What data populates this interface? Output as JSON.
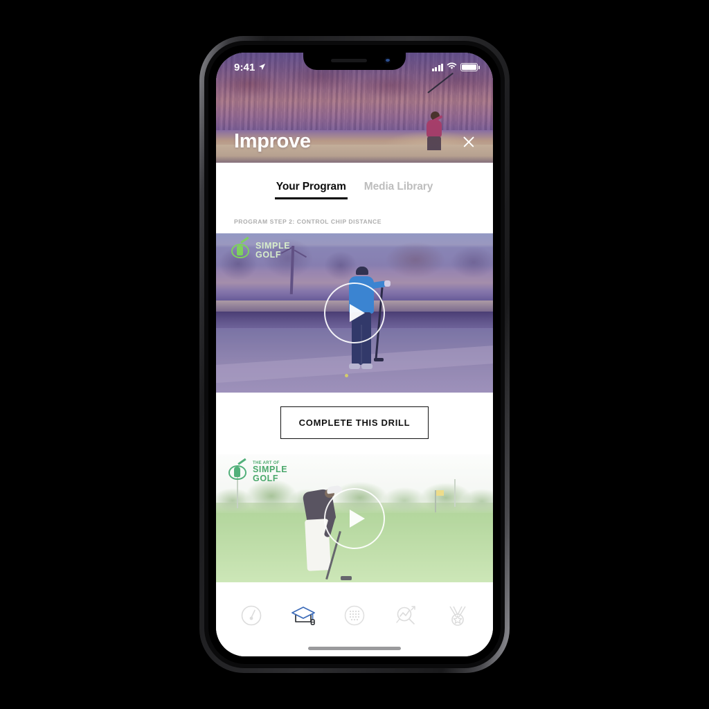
{
  "status_bar": {
    "time": "9:41",
    "location_icon": "location-arrow-icon",
    "signal_icon": "cellular-signal-icon",
    "wifi_icon": "wifi-icon",
    "battery_icon": "battery-icon"
  },
  "header": {
    "title": "Improve",
    "close_icon": "close-icon"
  },
  "tabs": [
    {
      "label": "Your Program",
      "active": true
    },
    {
      "label": "Media Library",
      "active": false
    }
  ],
  "section": {
    "label": "PROGRAM STEP 2: CONTROL CHIP DISTANCE"
  },
  "videos": [
    {
      "name": "drill-video",
      "play_icon": "play-icon",
      "logo": {
        "line1": "",
        "line2": "SIMPLE",
        "line3": "GOLF",
        "mark": "golf-swing-logo-icon"
      }
    },
    {
      "name": "secondary-video",
      "play_icon": "play-icon",
      "logo": {
        "line1": "THE ART OF",
        "line2": "SIMPLE",
        "line3": "GOLF",
        "mark": "golf-swing-logo-icon"
      }
    }
  ],
  "drill_button": {
    "label": "COMPLETE THIS DRILL"
  },
  "tabbar": {
    "items": [
      {
        "name": "tabbar-item-dashboard",
        "icon": "gauge-icon",
        "active": false
      },
      {
        "name": "tabbar-item-improve",
        "icon": "graduation-cap-icon",
        "active": true
      },
      {
        "name": "tabbar-item-practice",
        "icon": "golf-ball-icon",
        "active": false
      },
      {
        "name": "tabbar-item-stats",
        "icon": "analytics-search-icon",
        "active": false
      },
      {
        "name": "tabbar-item-awards",
        "icon": "medal-icon",
        "active": false
      }
    ],
    "active_color": "#3d6cb9",
    "inactive_color": "#dcdcdc"
  },
  "home_indicator": "home-indicator"
}
